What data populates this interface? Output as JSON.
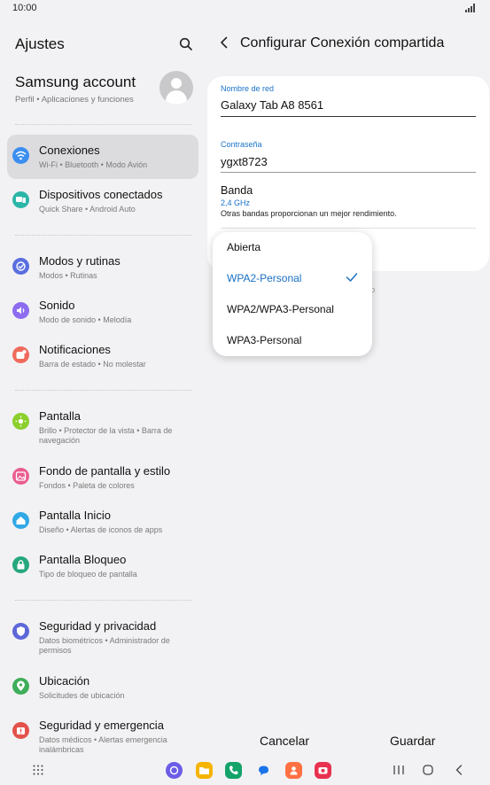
{
  "status_bar": {
    "time": "10:00"
  },
  "settings": {
    "title": "Ajustes",
    "account": {
      "name": "Samsung account",
      "subtitle": "Perfil  •  Aplicaciones y funciones"
    },
    "items": [
      {
        "title": "Conexiones",
        "subtitle": "Wi-Fi  •  Bluetooth  •  Modo Avión",
        "icon": "wifi-icon",
        "color": "#3b8ef0"
      },
      {
        "title": "Dispositivos conectados",
        "subtitle": "Quick Share  •  Android Auto",
        "icon": "devices-icon",
        "color": "#2bb6a8"
      },
      {
        "title": "Modos y rutinas",
        "subtitle": "Modos  •  Rutinas",
        "icon": "modes-icon",
        "color": "#5a6ee0"
      },
      {
        "title": "Sonido",
        "subtitle": "Modo de sonido  •  Melodía",
        "icon": "sound-icon",
        "color": "#8d6cf0"
      },
      {
        "title": "Notificaciones",
        "subtitle": "Barra de estado  •  No molestar",
        "icon": "notifications-icon",
        "color": "#ef6b5c"
      },
      {
        "title": "Pantalla",
        "subtitle": "Brillo  •  Protector de la vista  •  Barra de navegación",
        "icon": "display-icon",
        "color": "#8ccf2d"
      },
      {
        "title": "Fondo de pantalla y estilo",
        "subtitle": "Fondos  •  Paleta de colores",
        "icon": "wallpaper-icon",
        "color": "#ea5d91"
      },
      {
        "title": "Pantalla Inicio",
        "subtitle": "Diseño  •  Alertas de iconos de apps",
        "icon": "home-icon",
        "color": "#31a9e6"
      },
      {
        "title": "Pantalla Bloqueo",
        "subtitle": "Tipo de bloqueo de pantalla",
        "icon": "lock-icon",
        "color": "#26a77e"
      },
      {
        "title": "Seguridad y privacidad",
        "subtitle": "Datos biométricos  •  Administrador de permisos",
        "icon": "shield-icon",
        "color": "#5d67d8"
      },
      {
        "title": "Ubicación",
        "subtitle": "Solicitudes de ubicación",
        "icon": "location-icon",
        "color": "#3fae5a"
      },
      {
        "title": "Seguridad y emergencia",
        "subtitle": "Datos médicos  •  Alertas emergencia inalámbricas",
        "icon": "emergency-icon",
        "color": "#e3524b"
      }
    ]
  },
  "hotspot": {
    "title": "Configurar Conexión compartida",
    "network_name_label": "Nombre de red",
    "network_name_value": "Galaxy Tab A8 8561",
    "password_label": "Contraseña",
    "password_value": "ygxt8723",
    "band_label": "Banda",
    "band_value": "2,4 GHz",
    "band_description": "Otras bandas proporcionan un mejor rendimiento.",
    "partial_text": "o",
    "security_options": [
      "Abierta",
      "WPA2-Personal",
      "WPA2/WPA3-Personal",
      "WPA3-Personal"
    ],
    "selected_security": "WPA2-Personal",
    "cancel_label": "Cancelar",
    "save_label": "Guardar"
  },
  "colors": {
    "accent": "#1a73c8",
    "active_row": "#dcdcdf",
    "background": "#f2f2f4"
  }
}
